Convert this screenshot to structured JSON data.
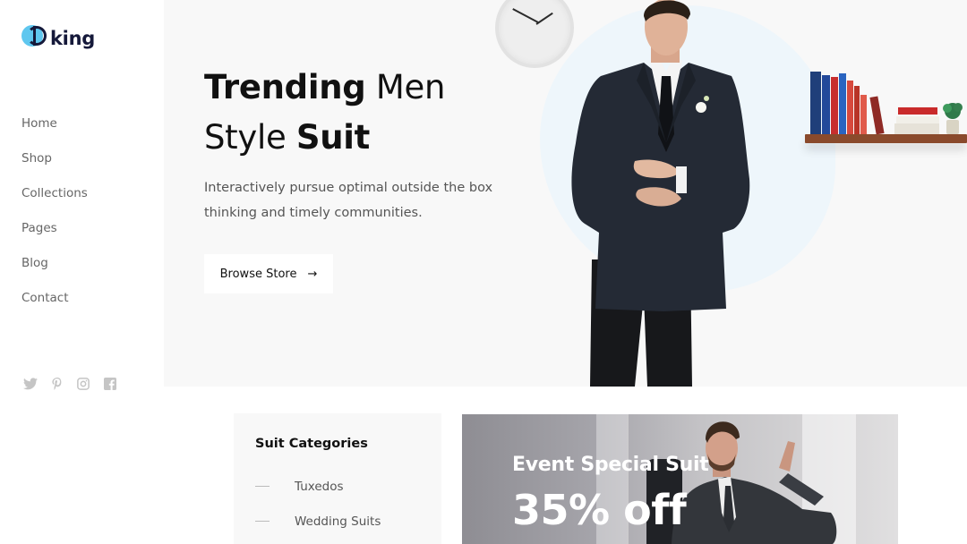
{
  "brand": {
    "logo_text": "king"
  },
  "nav": {
    "items": [
      {
        "label": "Home"
      },
      {
        "label": "Shop"
      },
      {
        "label": "Collections"
      },
      {
        "label": "Pages"
      },
      {
        "label": "Blog"
      },
      {
        "label": "Contact"
      }
    ]
  },
  "social": {
    "icons": [
      "twitter-icon",
      "pinterest-icon",
      "instagram-icon",
      "facebook-icon"
    ]
  },
  "hero": {
    "title_bold_1": "Trending",
    "title_light_1": " Men",
    "title_light_2": "Style ",
    "title_bold_2": "Suit",
    "description": "Interactively pursue optimal outside the box thinking and timely communities.",
    "button_label": "Browse Store",
    "button_arrow": "→"
  },
  "categories": {
    "title": "Suit Categories",
    "items": [
      "Tuxedos",
      "Wedding Suits"
    ]
  },
  "promo": {
    "subtitle": "Event Special Suit",
    "discount": "35% off"
  },
  "colors": {
    "logo_accent": "#5fc7ef",
    "logo_dark": "#15193a",
    "hero_bg": "#f8f8f8",
    "shelf": "#8a4a2c"
  }
}
